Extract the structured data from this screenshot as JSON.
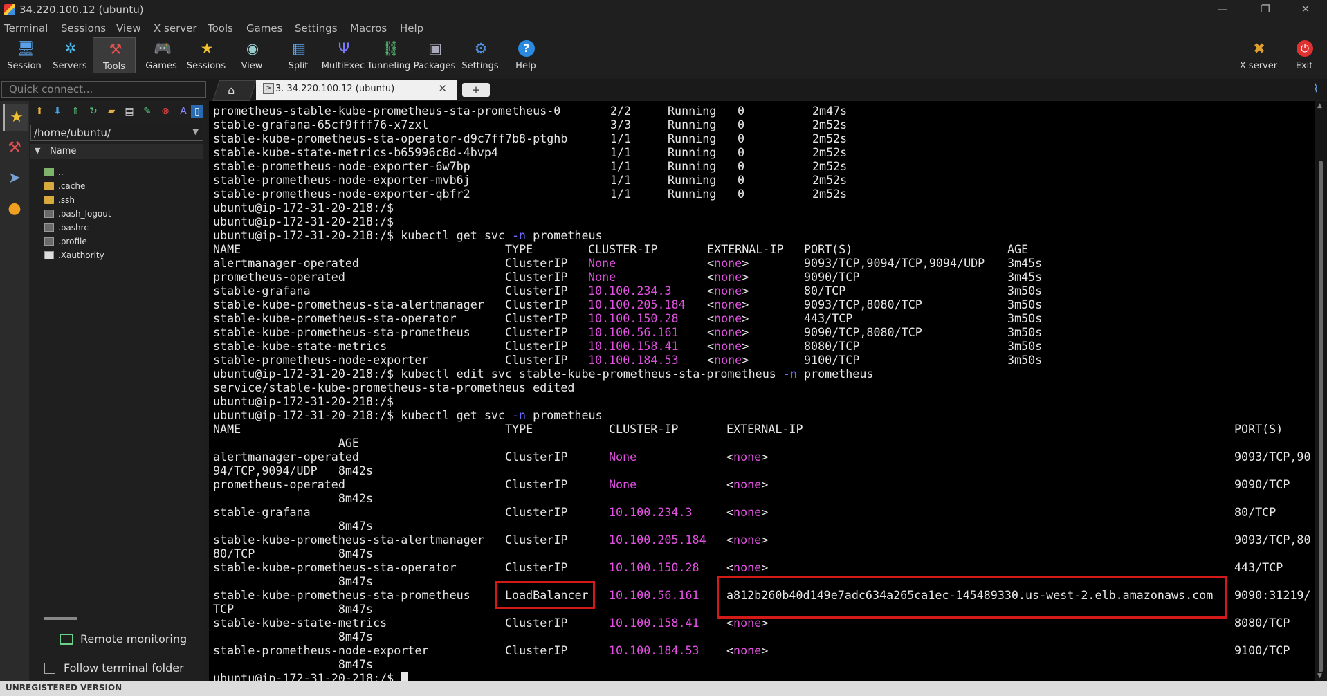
{
  "window": {
    "title": "34.220.100.12 (ubuntu)"
  },
  "menu": [
    "Terminal",
    "Sessions",
    "View",
    "X server",
    "Tools",
    "Games",
    "Settings",
    "Macros",
    "Help"
  ],
  "toolbar": {
    "left": [
      {
        "label": "Session",
        "icon": "session-icon"
      },
      {
        "label": "Servers",
        "icon": "servers-icon"
      },
      {
        "label": "Tools",
        "icon": "tools-icon"
      },
      {
        "label": "Games",
        "icon": "games-icon"
      },
      {
        "label": "Sessions",
        "icon": "star-icon"
      },
      {
        "label": "View",
        "icon": "view-icon"
      },
      {
        "label": "Split",
        "icon": "split-icon"
      },
      {
        "label": "MultiExec",
        "icon": "multiexec-icon"
      },
      {
        "label": "Tunneling",
        "icon": "tunneling-icon"
      },
      {
        "label": "Packages",
        "icon": "packages-icon"
      },
      {
        "label": "Settings",
        "icon": "settings-icon"
      },
      {
        "label": "Help",
        "icon": "help-icon"
      }
    ],
    "right": [
      {
        "label": "X server",
        "icon": "xserver-icon"
      },
      {
        "label": "Exit",
        "icon": "power-icon"
      }
    ]
  },
  "quick_connect": {
    "placeholder": "Quick connect..."
  },
  "tabs": {
    "session_tab_label": "3. 34.220.100.12 (ubuntu)",
    "close_glyph": "✕",
    "plus_glyph": "+"
  },
  "file_panel": {
    "path": "/home/ubuntu/",
    "column_header": "Name",
    "items": [
      {
        "name": "..",
        "kind": "up"
      },
      {
        "name": ".cache",
        "kind": "folder"
      },
      {
        "name": ".ssh",
        "kind": "folder"
      },
      {
        "name": ".bash_logout",
        "kind": "file"
      },
      {
        "name": ".bashrc",
        "kind": "file"
      },
      {
        "name": ".profile",
        "kind": "file"
      },
      {
        "name": ".Xauthority",
        "kind": "file"
      }
    ],
    "remote_monitoring": "Remote monitoring",
    "follow_terminal_folder": "Follow terminal folder",
    "follow_checked": false
  },
  "terminal": {
    "pods": [
      {
        "name": "prometheus-stable-kube-prometheus-sta-prometheus-0",
        "ready": "2/2",
        "status": "Running",
        "restarts": "0",
        "age": "2m47s"
      },
      {
        "name": "stable-grafana-65cf9fff76-x7zxl",
        "ready": "3/3",
        "status": "Running",
        "restarts": "0",
        "age": "2m52s"
      },
      {
        "name": "stable-kube-prometheus-sta-operator-d9c7ff7b8-ptghb",
        "ready": "1/1",
        "status": "Running",
        "restarts": "0",
        "age": "2m52s"
      },
      {
        "name": "stable-kube-state-metrics-b65996c8d-4bvp4",
        "ready": "1/1",
        "status": "Running",
        "restarts": "0",
        "age": "2m52s"
      },
      {
        "name": "stable-prometheus-node-exporter-6w7bp",
        "ready": "1/1",
        "status": "Running",
        "restarts": "0",
        "age": "2m52s"
      },
      {
        "name": "stable-prometheus-node-exporter-mvb6j",
        "ready": "1/1",
        "status": "Running",
        "restarts": "0",
        "age": "2m52s"
      },
      {
        "name": "stable-prometheus-node-exporter-qbfr2",
        "ready": "1/1",
        "status": "Running",
        "restarts": "0",
        "age": "2m52s"
      }
    ],
    "prompt": "ubuntu@ip-172-31-20-218:/$",
    "cmd1_a": "kubectl get svc ",
    "flag_n": "-n",
    "cmd1_b": " prometheus",
    "headers": {
      "name": "NAME",
      "type": "TYPE",
      "cluster_ip": "CLUSTER-IP",
      "external_ip": "EXTERNAL-IP",
      "ports": "PORT(S)",
      "age": "AGE"
    },
    "svc1": [
      {
        "name": "alertmanager-operated",
        "type": "ClusterIP",
        "cluster_ip": "None",
        "external_ip": "<none>",
        "ports": "9093/TCP,9094/TCP,9094/UDP",
        "age": "3m45s"
      },
      {
        "name": "prometheus-operated",
        "type": "ClusterIP",
        "cluster_ip": "None",
        "external_ip": "<none>",
        "ports": "9090/TCP",
        "age": "3m45s"
      },
      {
        "name": "stable-grafana",
        "type": "ClusterIP",
        "cluster_ip": "10.100.234.3",
        "external_ip": "<none>",
        "ports": "80/TCP",
        "age": "3m50s"
      },
      {
        "name": "stable-kube-prometheus-sta-alertmanager",
        "type": "ClusterIP",
        "cluster_ip": "10.100.205.184",
        "external_ip": "<none>",
        "ports": "9093/TCP,8080/TCP",
        "age": "3m50s"
      },
      {
        "name": "stable-kube-prometheus-sta-operator",
        "type": "ClusterIP",
        "cluster_ip": "10.100.150.28",
        "external_ip": "<none>",
        "ports": "443/TCP",
        "age": "3m50s"
      },
      {
        "name": "stable-kube-prometheus-sta-prometheus",
        "type": "ClusterIP",
        "cluster_ip": "10.100.56.161",
        "external_ip": "<none>",
        "ports": "9090/TCP,8080/TCP",
        "age": "3m50s"
      },
      {
        "name": "stable-kube-state-metrics",
        "type": "ClusterIP",
        "cluster_ip": "10.100.158.41",
        "external_ip": "<none>",
        "ports": "8080/TCP",
        "age": "3m50s"
      },
      {
        "name": "stable-prometheus-node-exporter",
        "type": "ClusterIP",
        "cluster_ip": "10.100.184.53",
        "external_ip": "<none>",
        "ports": "9100/TCP",
        "age": "3m50s"
      }
    ],
    "cmd2_a": "kubectl edit svc stable-kube-prometheus-sta-prometheus ",
    "cmd2_b": " prometheus",
    "edited_msg": "service/stable-kube-prometheus-sta-prometheus edited",
    "svc2": [
      {
        "name": "alertmanager-operated",
        "type": "ClusterIP",
        "cluster_ip": "None",
        "external_ip": "<none>",
        "ports": "9093/TCP,90",
        "wrap": "94/TCP,9094/UDP   8m42s"
      },
      {
        "name": "prometheus-operated",
        "type": "ClusterIP",
        "cluster_ip": "None",
        "external_ip": "<none>",
        "ports": "9090/TCP",
        "wrap": "                  8m42s"
      },
      {
        "name": "stable-grafana",
        "type": "ClusterIP",
        "cluster_ip": "10.100.234.3",
        "external_ip": "<none>",
        "ports": "80/TCP",
        "wrap": "                  8m47s"
      },
      {
        "name": "stable-kube-prometheus-sta-alertmanager",
        "type": "ClusterIP",
        "cluster_ip": "10.100.205.184",
        "external_ip": "<none>",
        "ports": "9093/TCP,80",
        "wrap": "80/TCP            8m47s"
      },
      {
        "name": "stable-kube-prometheus-sta-operator",
        "type": "ClusterIP",
        "cluster_ip": "10.100.150.28",
        "external_ip": "<none>",
        "ports": "443/TCP",
        "wrap": "                  8m47s"
      },
      {
        "name": "stable-kube-prometheus-sta-prometheus",
        "type": "LoadBalancer",
        "cluster_ip": "10.100.56.161",
        "external_ip": "a812b260b40d149e7adc634a265ca1ec-145489330.us-west-2.elb.amazonaws.com",
        "ports": "9090:31219/",
        "wrap": "TCP               8m47s"
      },
      {
        "name": "stable-kube-state-metrics",
        "type": "ClusterIP",
        "cluster_ip": "10.100.158.41",
        "external_ip": "<none>",
        "ports": "8080/TCP",
        "wrap": "                  8m47s"
      },
      {
        "name": "stable-prometheus-node-exporter",
        "type": "ClusterIP",
        "cluster_ip": "10.100.184.53",
        "external_ip": "<none>",
        "ports": "9100/TCP",
        "wrap": "                  8m47s"
      }
    ],
    "age_header_wrapped": "                  AGE"
  },
  "status_bar": "UNREGISTERED VERSION",
  "colors": {
    "ip_magenta": "#e251e2",
    "flag_blue": "#6b6bff",
    "highlight_red": "#d41919"
  }
}
